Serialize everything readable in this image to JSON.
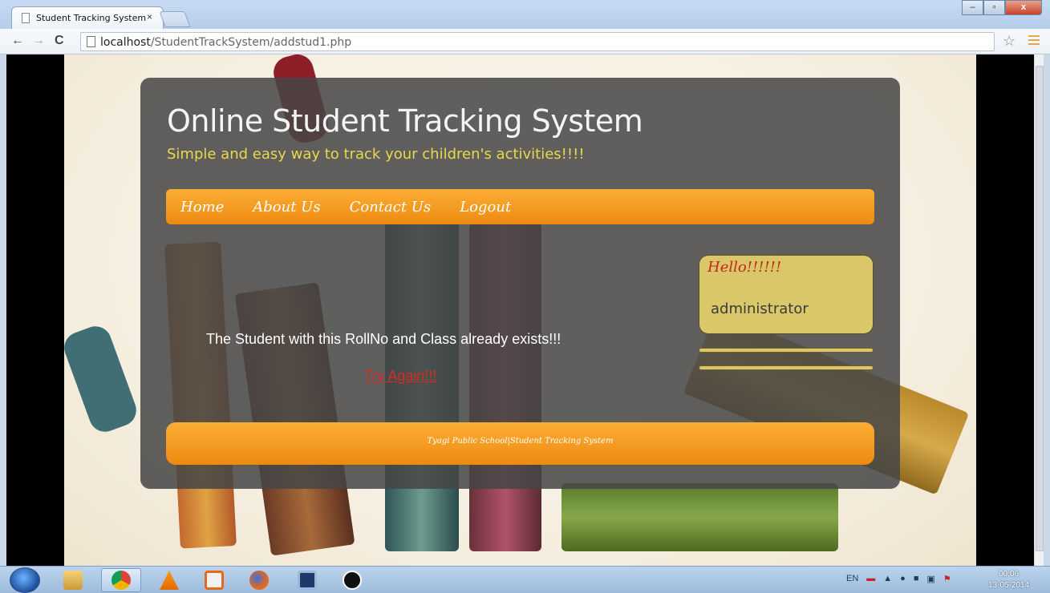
{
  "browser": {
    "tab_title": "Student Tracking System",
    "tab_close": "×",
    "url_host": "localhost",
    "url_path": "/StudentTrackSystem/addstud1.php",
    "back_glyph": "←",
    "forward_glyph": "→",
    "reload_glyph": "C",
    "bookmark_star": "☆",
    "window_buttons": [
      "–",
      "▫",
      "x"
    ]
  },
  "site": {
    "title": "Online Student Tracking System",
    "subtitle": "Simple and easy way to track your children's activities!!!!",
    "nav": [
      "Home",
      "About Us",
      "Contact Us",
      "Logout"
    ],
    "message": "The Student with this RollNo and Class already exists!!!",
    "retry_link": "Try Again!!!",
    "sidebar": {
      "greeting": "Hello!!!!!!",
      "username": "administrator"
    },
    "footer": "Tyagi Public School|Student Tracking System"
  },
  "taskbar": {
    "language": "EN",
    "time": "00:06",
    "date": "13-05-2014",
    "apps": [
      "explorer-icon",
      "chrome-icon",
      "vlc-icon",
      "media-icon",
      "firefox-icon",
      "window-icon",
      "app-p-icon"
    ]
  },
  "colors": {
    "accent_orange": "#f59a1c",
    "subtitle_yellow": "#e8d84a",
    "link_red": "#d62b22",
    "panel_gray": "#464646"
  }
}
